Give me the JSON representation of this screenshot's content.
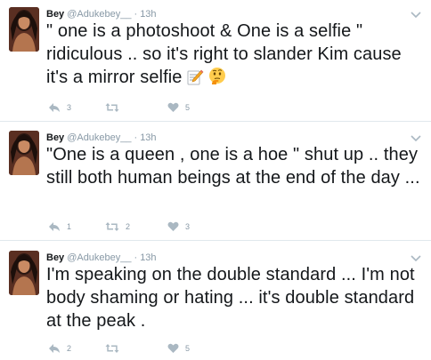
{
  "tweets": [
    {
      "name": "Bey",
      "handle": "@Adukebey__",
      "separator": "·",
      "time": "13h",
      "text": "\" one is a photoshoot & One is a selfie \" ridiculous .. so it's right to slander Kim cause it's a mirror selfie",
      "emojis": [
        "memo-emoji",
        "thinking-face-emoji"
      ],
      "replies": "3",
      "retweets": "",
      "likes": "5"
    },
    {
      "name": "Bey",
      "handle": "@Adukebey__",
      "separator": "·",
      "time": "13h",
      "text": "\"One is a queen , one is a hoe \" shut up .. they still both human beings at the end of the day ...",
      "emojis": [],
      "replies": "1",
      "retweets": "2",
      "likes": "3"
    },
    {
      "name": "Bey",
      "handle": "@Adukebey__",
      "separator": "·",
      "time": "13h",
      "text": "I'm speaking on the double standard ... I'm not body shaming or hating ... it's double standard at the peak .",
      "emojis": [],
      "replies": "2",
      "retweets": "",
      "likes": "5"
    }
  ],
  "icons": {
    "reply": "reply-icon",
    "retweet": "retweet-icon",
    "like": "heart-icon",
    "caret": "chevron-down-icon"
  },
  "colors": {
    "text": "#14171a",
    "meta": "#8899a6",
    "icon": "#aab8c2",
    "divider": "#e1e8ed"
  }
}
